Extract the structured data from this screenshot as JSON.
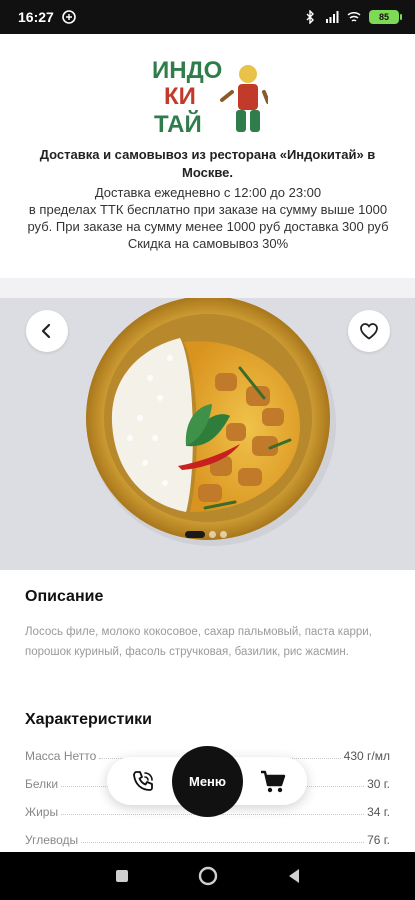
{
  "status_bar": {
    "time": "16:27",
    "battery": "85"
  },
  "header": {
    "logo_text": [
      "ИНДО",
      "КИ",
      "ТАЙ"
    ],
    "restaurant_line": "Доставка и самовывоз из ресторана «Индокитай» в Москве.",
    "delivery_lines": [
      "Доставка ежедневно с 12:00 до 23:00",
      "в пределах ТТК бесплатно при заказе на сумму выше 1000 руб. При заказе на сумму менее 1000 руб доставка 300 руб",
      "Скидка на самовывоз 30%"
    ]
  },
  "gallery": {
    "slides": 3,
    "active_slide": 1
  },
  "description": {
    "title": "Описание",
    "text": "Лосось филе, молоко кокосовое, сахар пальмовый, паста карри, порошок куриный, фасоль стручковая, базилик, рис жасмин."
  },
  "characteristics": {
    "title": "Характеристики",
    "rows": [
      {
        "label": "Масса Нетто",
        "value": "430 г/мл"
      },
      {
        "label": "Белки",
        "value": "30 г."
      },
      {
        "label": "Жиры",
        "value": "34 г."
      },
      {
        "label": "Углеводы",
        "value": "76 г."
      }
    ]
  },
  "bottom_nav": {
    "menu_label": "Меню",
    "icons": [
      "phone-icon",
      "cart-icon"
    ]
  },
  "colors": {
    "accent_dark": "#111111",
    "hero_bg": "#dcdde2",
    "battery": "#7ed957",
    "plate": "#c99a2e",
    "curry": "#e3a32a"
  }
}
